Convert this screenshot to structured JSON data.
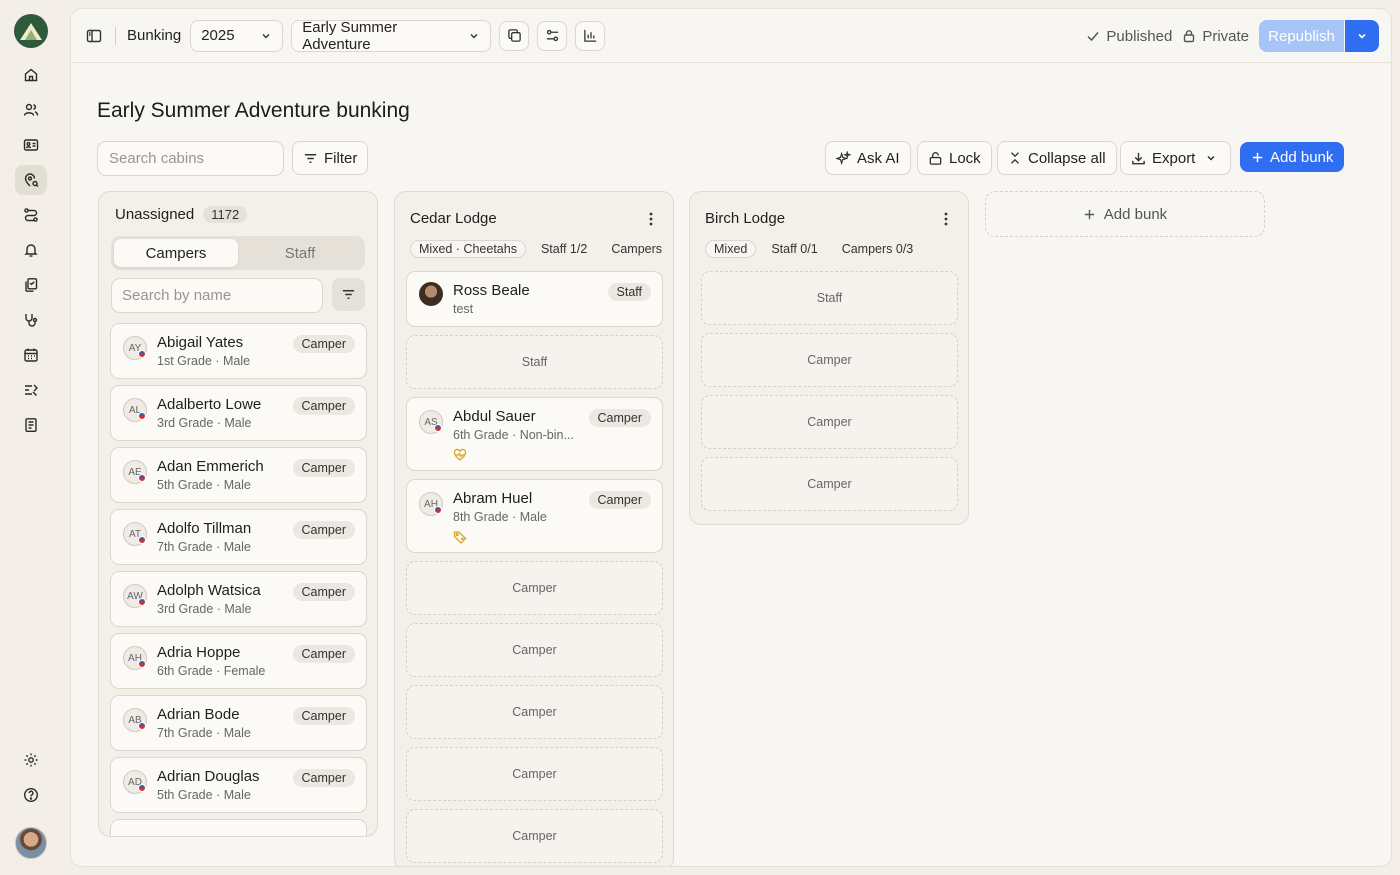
{
  "topbar": {
    "app_title": "Bunking",
    "year": "2025",
    "session": "Early Summer Adventure",
    "status_published": "Published",
    "status_private": "Private",
    "republish": "Republish"
  },
  "page": {
    "title": "Early Summer Adventure bunking"
  },
  "toolbar": {
    "search_placeholder": "Search cabins",
    "filter": "Filter",
    "ask_ai": "Ask AI",
    "lock": "Lock",
    "collapse_all": "Collapse all",
    "export": "Export",
    "add_bunk": "Add bunk"
  },
  "unassigned": {
    "title": "Unassigned",
    "count": "1172",
    "tabs": [
      "Campers",
      "Staff"
    ],
    "search_placeholder": "Search by name",
    "people": [
      {
        "initials": "AY",
        "name": "Abigail Yates",
        "sub": "1st Grade · Male",
        "role": "Camper"
      },
      {
        "initials": "AL",
        "name": "Adalberto Lowe",
        "sub": "3rd Grade · Male",
        "role": "Camper"
      },
      {
        "initials": "AE",
        "name": "Adan Emmerich",
        "sub": "5th Grade · Male",
        "role": "Camper"
      },
      {
        "initials": "AT",
        "name": "Adolfo Tillman",
        "sub": "7th Grade · Male",
        "role": "Camper"
      },
      {
        "initials": "AW",
        "name": "Adolph Watsica",
        "sub": "3rd Grade · Male",
        "role": "Camper"
      },
      {
        "initials": "AH",
        "name": "Adria Hoppe",
        "sub": "6th Grade · Female",
        "role": "Camper"
      },
      {
        "initials": "AB",
        "name": "Adrian Bode",
        "sub": "7th Grade · Male",
        "role": "Camper"
      },
      {
        "initials": "AD",
        "name": "Adrian Douglas",
        "sub": "5th Grade · Male",
        "role": "Camper"
      }
    ]
  },
  "cabins": [
    {
      "name": "Cedar Lodge",
      "chips": [
        "Mixed · Cheetahs",
        "Staff 1/2",
        "Campers"
      ],
      "members": [
        {
          "name": "Ross Beale",
          "sub": "test",
          "role": "Staff"
        },
        {
          "initials": "AS",
          "name": "Abdul Sauer",
          "sub": "6th Grade · Non-bin...",
          "role": "Camper"
        },
        {
          "initials": "AH",
          "name": "Abram Huel",
          "sub": "8th Grade · Male",
          "role": "Camper"
        }
      ],
      "slots": [
        "Staff",
        "Camper",
        "Camper",
        "Camper",
        "Camper",
        "Camper"
      ]
    },
    {
      "name": "Birch Lodge",
      "chips": [
        "Mixed",
        "Staff 0/1",
        "Campers 0/3"
      ],
      "slots": [
        "Staff",
        "Camper",
        "Camper",
        "Camper"
      ]
    }
  ],
  "add_bunk_column": "Add bunk",
  "colors": {
    "accent": "#2f6ef0",
    "republish_disabled": "#a7c4f7",
    "background": "#f3efe8"
  }
}
